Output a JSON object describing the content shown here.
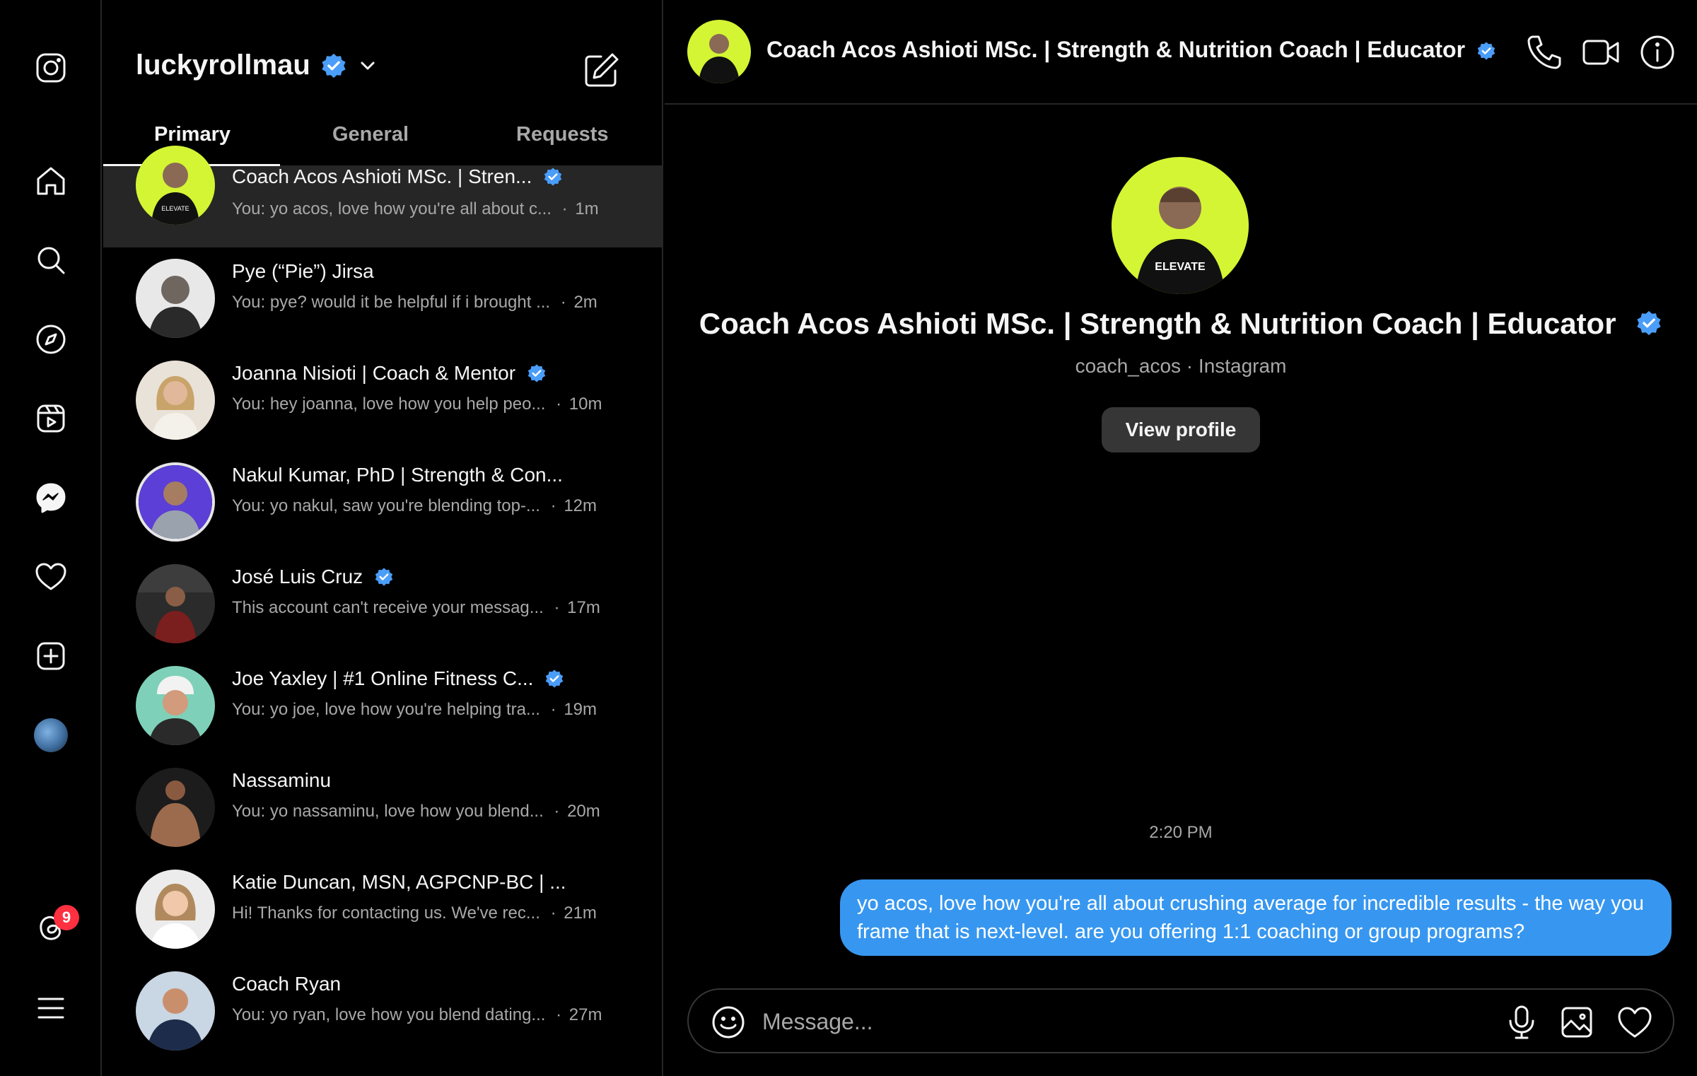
{
  "account": {
    "username": "luckyrollmau",
    "verified": true
  },
  "tabs": [
    {
      "label": "Primary",
      "active": true
    },
    {
      "label": "General",
      "active": false
    },
    {
      "label": "Requests",
      "active": false
    }
  ],
  "conversations": [
    {
      "name": "Coach Acos Ashioti MSc. | Stren...",
      "verified": true,
      "preview": "You: yo acos, love how you're all about c...",
      "time": "1m",
      "selected": true
    },
    {
      "name": "Pye (“Pie”) Jirsa",
      "verified": false,
      "preview": "You: pye? would it be helpful if i brought ...",
      "time": "2m"
    },
    {
      "name": "Joanna Nisioti | Coach & Mentor",
      "verified": true,
      "preview": "You: hey joanna, love how you help peo...",
      "time": "10m"
    },
    {
      "name": "Nakul Kumar, PhD | Strength & Con...",
      "verified": false,
      "preview": "You: yo nakul, saw you're blending top-...",
      "time": "12m"
    },
    {
      "name": "José Luis Cruz",
      "verified": true,
      "preview": "This account can't receive your messag...",
      "time": "17m"
    },
    {
      "name": "Joe Yaxley | #1 Online Fitness C...",
      "verified": true,
      "preview": "You: yo joe, love how you're helping tra...",
      "time": "19m"
    },
    {
      "name": "Nassaminu",
      "verified": false,
      "preview": "You: yo nassaminu, love how you blend...",
      "time": "20m"
    },
    {
      "name": "Katie Duncan, MSN, AGPCNP-BC | ...",
      "verified": false,
      "preview": "Hi! Thanks for contacting us. We've rec...",
      "time": "21m"
    },
    {
      "name": "Coach Ryan",
      "verified": false,
      "preview": "You: yo ryan, love how you blend dating...",
      "time": "27m"
    }
  ],
  "chat": {
    "header_name": "Coach Acos Ashioti MSc. | Strength & Nutrition Coach | Educator",
    "profile_name": "Coach Acos Ashioti MSc. | Strength & Nutrition Coach | Educator",
    "profile_sub": "coach_acos · Instagram",
    "view_profile_label": "View profile",
    "timestamp": "2:20 PM",
    "messages": [
      {
        "from": "me",
        "text": "yo acos, love how you're all about crushing average for incredible results - the way you frame that is next-level. are you offering 1:1 coaching or group programs?"
      }
    ],
    "composer_placeholder": "Message..."
  },
  "notifications_count": "9",
  "rail_icons": [
    "instagram-logo-icon",
    "home-icon",
    "search-icon",
    "explore-compass-icon",
    "reels-icon",
    "messenger-icon",
    "heart-icon",
    "create-plus-icon",
    "profile-avatar",
    "threads-icon",
    "menu-hamburger-icon"
  ],
  "colors": {
    "background": "#000000",
    "bubble": "#3797f0",
    "verified": "#4a9df8",
    "selected_row": "#262626",
    "badge": "#ff3040"
  }
}
